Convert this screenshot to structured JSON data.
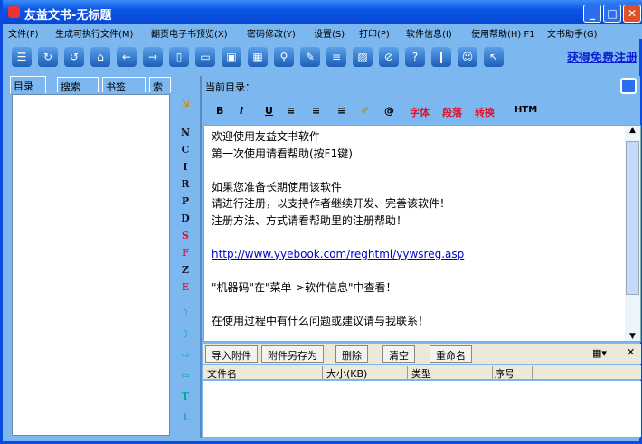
{
  "window": {
    "title": "友益文书-无标题"
  },
  "menu": [
    "文件(F)",
    "生成可执行文件(M)",
    "翻页电子书预览(X)",
    "密码修改(Y)",
    "设置(S)",
    "打印(P)",
    "软件信息(I)",
    "使用帮助(H) F1",
    "文书助手(G)"
  ],
  "toolbar": {
    "icons": [
      "list-icon",
      "redo-icon",
      "undo-icon",
      "home-icon",
      "back-icon",
      "forward-icon",
      "new-icon",
      "open-icon",
      "save-icon",
      "saveas-icon",
      "search-icon",
      "edit-icon",
      "page-icon",
      "image-icon",
      "link-icon",
      "help-icon",
      "book-icon",
      "smile-icon",
      "pointer-icon"
    ],
    "glyphs": [
      "☰",
      "↻",
      "↺",
      "⌂",
      "←",
      "→",
      "▯",
      "▭",
      "▣",
      "▦",
      "⚲",
      "✎",
      "≡",
      "▨",
      "⊘",
      "?",
      "❙",
      "☺",
      "↖"
    ],
    "register_link": "获得免费注册"
  },
  "left_tabs": [
    "目录",
    "搜索",
    "书签",
    "索引"
  ],
  "strip": {
    "letters": [
      "N",
      "C",
      "I",
      "R",
      "P",
      "D",
      "S",
      "F",
      "Z",
      "E"
    ],
    "arrows": [
      "⇧",
      "⇩",
      "⇨",
      "⇦",
      "T",
      "⊥"
    ]
  },
  "right": {
    "current_dir_label": "当前目录：",
    "format": {
      "bold": "B",
      "italic": "I",
      "underline": "U",
      "font": "字体",
      "para": "段落",
      "convert": "转换",
      "html": "HTM"
    },
    "editor_lines": [
      "欢迎使用友益文书软件",
      "第一次使用请看帮助(按F1键)",
      "",
      "如果您准备长期使用该软件",
      "请进行注册，以支持作者继续开发、完善该软件！",
      "注册方法、方式请看帮助里的注册帮助！",
      ""
    ],
    "editor_link": "http://www.yyebook.com/reghtml/yywsreg.asp",
    "editor_lines2": [
      "",
      "\"机器码\"在\"菜单->软件信息\"中查看！",
      "",
      "在使用过程中有什么问题或建议请与我联系！"
    ],
    "attach_buttons": [
      "导入附件",
      "附件另存为",
      "删除",
      "清空",
      "重命名"
    ],
    "columns": [
      "文件名",
      "大小(KB)",
      "类型",
      "序号"
    ]
  }
}
